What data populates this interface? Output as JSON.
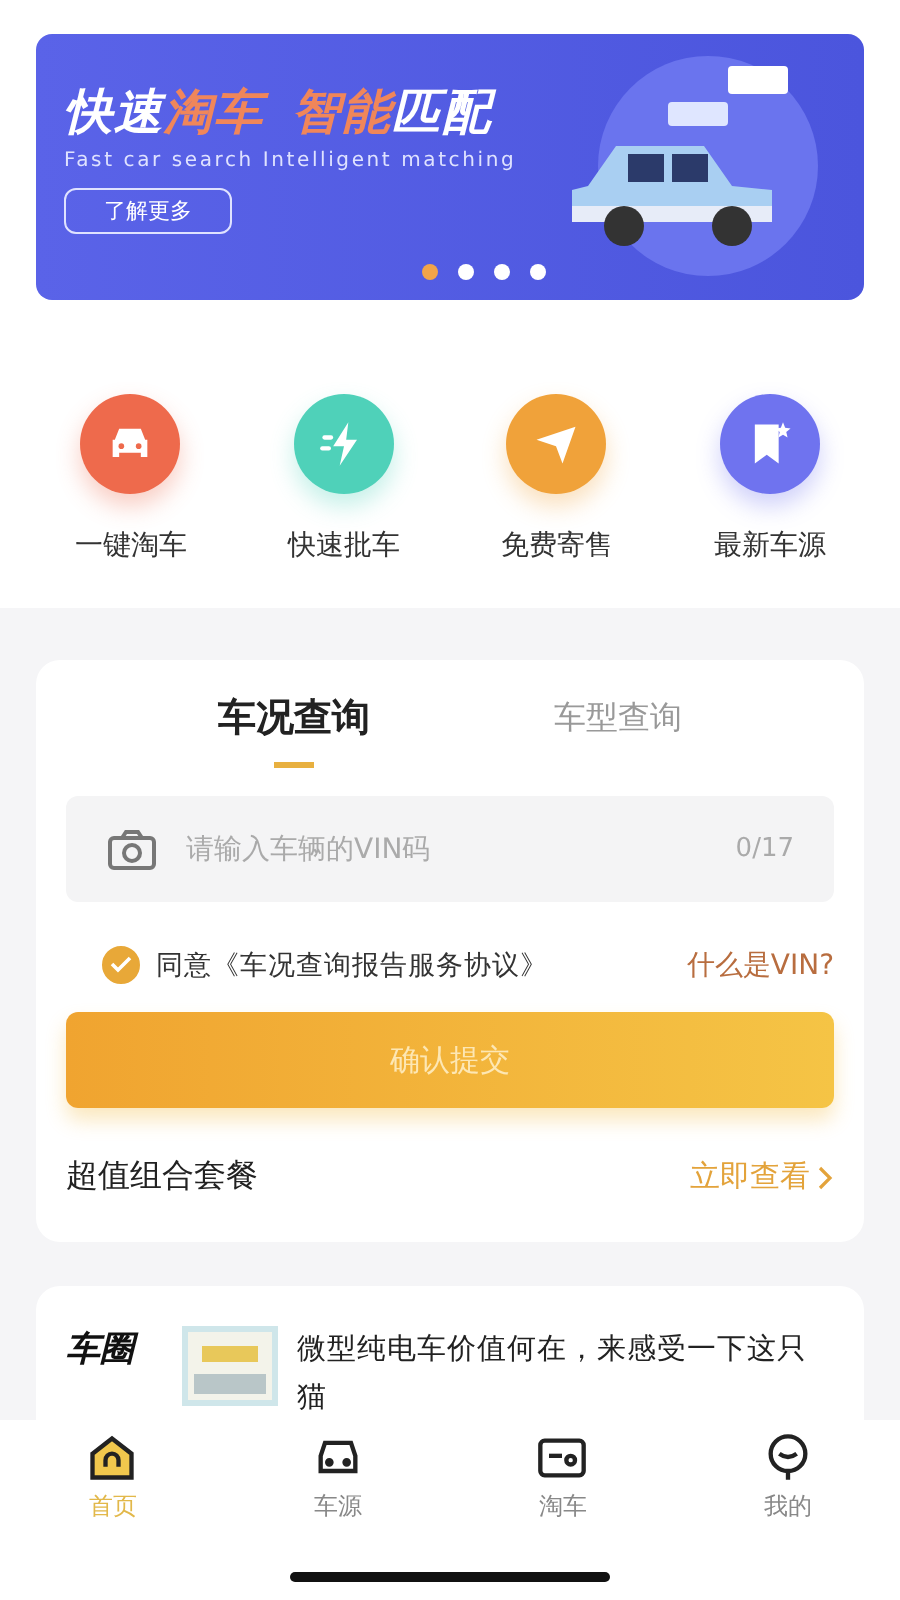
{
  "banner": {
    "title_parts": [
      {
        "text": "快速",
        "accent": false
      },
      {
        "text": "淘车",
        "accent": true
      },
      {
        "text": "智能",
        "accent": true
      },
      {
        "text": "匹配",
        "accent": false
      }
    ],
    "subtitle": "Fast car search Intelligent matching",
    "button": "了解更多",
    "dots": [
      {
        "selected": true
      },
      {
        "selected": false
      },
      {
        "selected": false
      },
      {
        "selected": false
      }
    ]
  },
  "shortcuts": [
    {
      "label": "一键淘车",
      "kind": "car",
      "color": "#ee6a4c"
    },
    {
      "label": "快速批车",
      "kind": "bolt",
      "color": "#4fd1b9"
    },
    {
      "label": "免费寄售",
      "kind": "send",
      "color": "#f0a23a"
    },
    {
      "label": "最新车源",
      "kind": "star",
      "color": "#6f73ef"
    }
  ],
  "query": {
    "tabs": [
      {
        "label": "车况查询",
        "selected": true
      },
      {
        "label": "车型查询",
        "selected": false
      }
    ],
    "vin_field": {
      "placeholder": "请输入车辆的VIN码",
      "counter": "0/17"
    },
    "agreement": {
      "checked": true,
      "text": "同意《车况查询报告服务协议》"
    },
    "help_link": "什么是VIN?",
    "submit": "确认提交",
    "package": {
      "label": "超值组合套餐",
      "link": "立即查看"
    }
  },
  "news": {
    "logo": "车圈",
    "headline": "微型纯电车价值何在，来感受一下这只猫"
  },
  "tab_bar": [
    {
      "label": "首页",
      "kind": "home",
      "selected": true
    },
    {
      "label": "车源",
      "kind": "car",
      "selected": false
    },
    {
      "label": "淘车",
      "kind": "card",
      "selected": false
    },
    {
      "label": "我的",
      "kind": "face",
      "selected": false
    }
  ]
}
